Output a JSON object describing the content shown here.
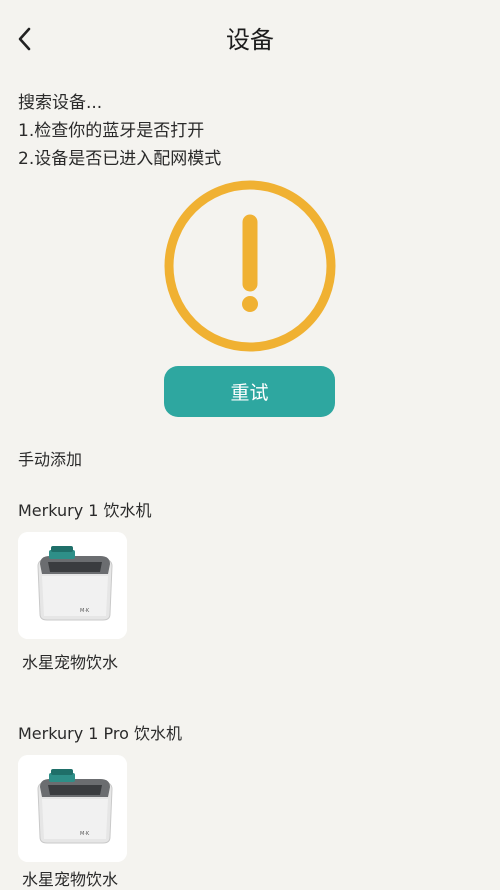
{
  "header": {
    "title": "设备"
  },
  "hints": {
    "searching": "搜索设备...",
    "step1": "1.检查你的蓝牙是否打开",
    "step2": "2.设备是否已进入配网模式"
  },
  "retry_label": "重试",
  "manual_add_label": "手动添加",
  "colors": {
    "warning": "#f0b132",
    "accent": "#2ea7a0",
    "background": "#f4f3ef"
  },
  "groups": [
    {
      "title": "Merkury 1 饮水机",
      "device": {
        "name": "水星宠物饮水",
        "icon": "pet-fountain-image"
      }
    },
    {
      "title": "Merkury 1 Pro 饮水机",
      "device": {
        "name": "水星宠物饮水",
        "icon": "pet-fountain-image"
      }
    }
  ]
}
